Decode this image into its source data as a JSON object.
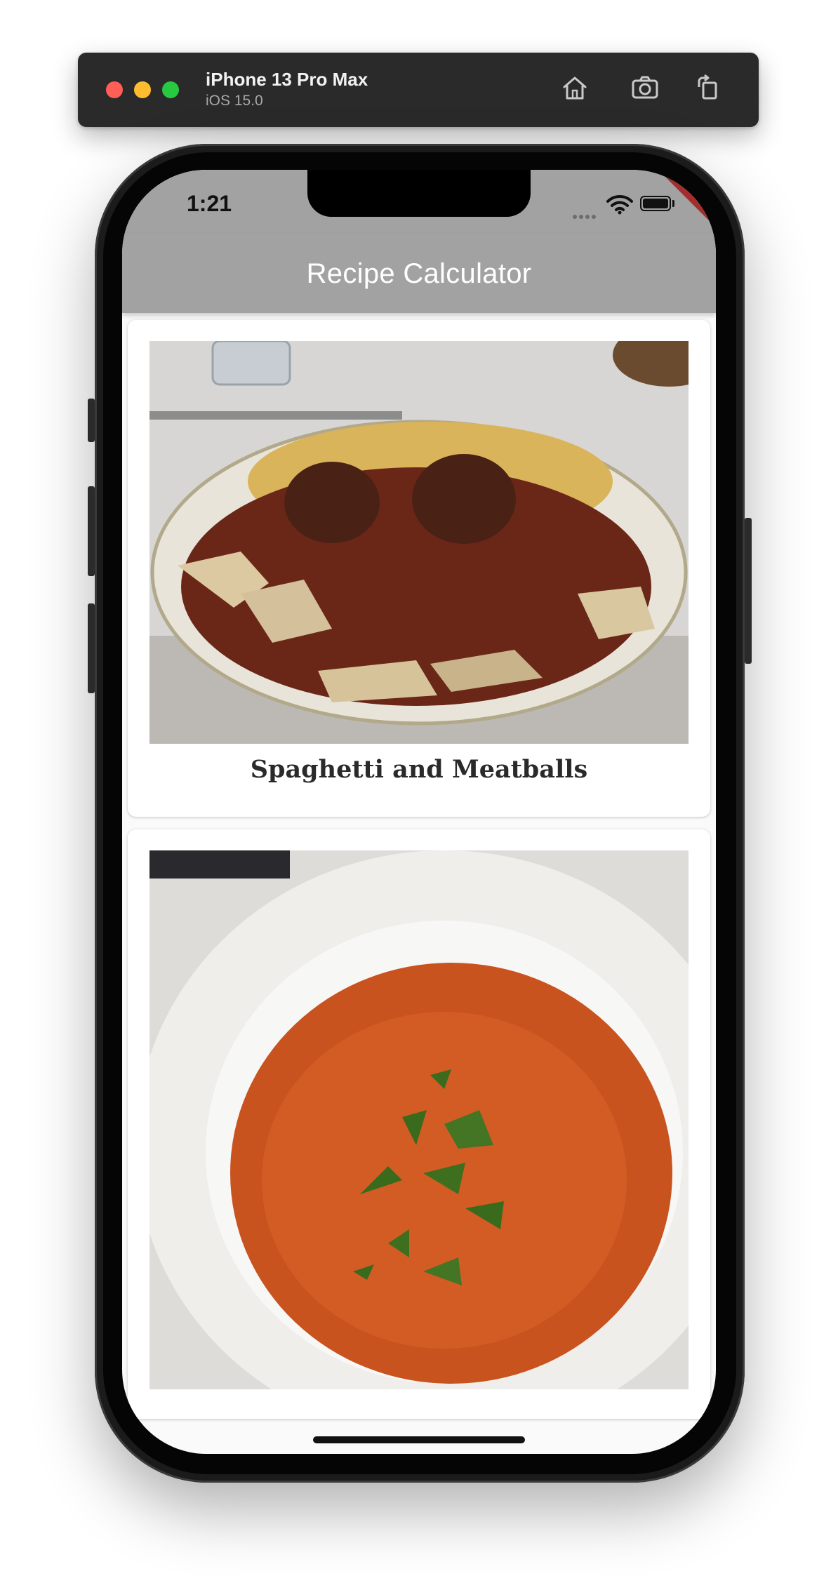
{
  "simulator": {
    "device_name": "iPhone 13 Pro Max",
    "os_version": "iOS 15.0",
    "toolbar_icons": [
      "home-icon",
      "screenshot-icon",
      "rotate-icon"
    ]
  },
  "status_bar": {
    "time": "1:21",
    "icons": [
      "signal-dots-icon",
      "wifi-icon",
      "battery-icon"
    ]
  },
  "debug_banner": "DEBUG",
  "app_bar": {
    "title": "Recipe Calculator",
    "color": "#a2a2a2"
  },
  "recipes": [
    {
      "label": "Spaghetti and Meatballs",
      "image": "spaghetti-meatballs-photo"
    },
    {
      "label": "",
      "image": "tomato-soup-photo"
    }
  ]
}
